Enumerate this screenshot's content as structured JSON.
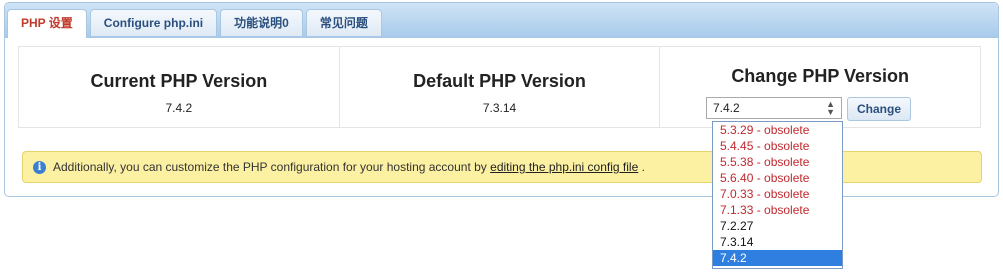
{
  "tabs": [
    {
      "label": "PHP 设置",
      "active": true
    },
    {
      "label": "Configure php.ini",
      "active": false
    },
    {
      "label": "功能说明0",
      "active": false
    },
    {
      "label": "常见问题",
      "active": false
    }
  ],
  "current": {
    "title": "Current PHP Version",
    "version": "7.4.2"
  },
  "default": {
    "title": "Default PHP Version",
    "version": "7.3.14"
  },
  "change": {
    "title": "Change PHP Version",
    "selected": "7.4.2",
    "button_label": "Change",
    "options": [
      {
        "label": "5.3.29 - obsolete",
        "obsolete": true,
        "selected": false
      },
      {
        "label": "5.4.45 - obsolete",
        "obsolete": true,
        "selected": false
      },
      {
        "label": "5.5.38 - obsolete",
        "obsolete": true,
        "selected": false
      },
      {
        "label": "5.6.40 - obsolete",
        "obsolete": true,
        "selected": false
      },
      {
        "label": "7.0.33 - obsolete",
        "obsolete": true,
        "selected": false
      },
      {
        "label": "7.1.33 - obsolete",
        "obsolete": true,
        "selected": false
      },
      {
        "label": "7.2.27",
        "obsolete": false,
        "selected": false
      },
      {
        "label": "7.3.14",
        "obsolete": false,
        "selected": false
      },
      {
        "label": "7.4.2",
        "obsolete": false,
        "selected": true
      }
    ]
  },
  "notice": {
    "icon": "info-icon",
    "text_before": "Additionally, you can customize the PHP configuration for your hosting account by ",
    "link_text": "editing the php.ini config file",
    "text_after": " ."
  },
  "colors": {
    "obsolete": "#c0282d",
    "selected_option": "#2f7fe0",
    "notice_bg": "#fcf0a2",
    "active_tab": "#c0392b"
  }
}
